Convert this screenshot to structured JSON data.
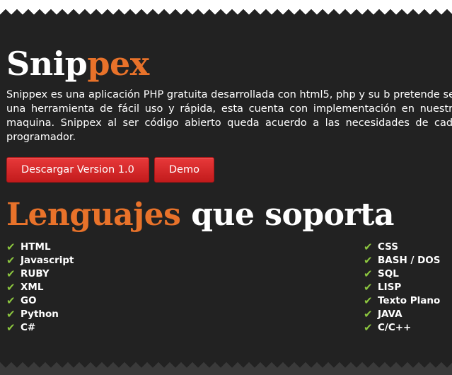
{
  "header": {
    "logo_main": "Snip",
    "logo_accent": "pex",
    "description": "Snippex es una aplicación PHP gratuita desarrollada con html5, php y su b pretende ser una herramienta de fácil uso y rápida, esta cuenta con implementación en nuestra maquina. Snippex al ser código abierto queda acuerdo a las necesidades de cada programador."
  },
  "buttons": {
    "download_label": "Descargar Version 1.0",
    "demo_label": "Demo"
  },
  "languages": {
    "title_accent": "Lenguajes",
    "title_rest": " que soporta",
    "left": [
      "HTML",
      "Javascript",
      "RUBY",
      "XML",
      "GO",
      "Python",
      "C#"
    ],
    "right": [
      "CSS",
      "BASH / DOS",
      "SQL",
      "LISP",
      "Texto Plano",
      "JAVA",
      "C/C++"
    ]
  },
  "colors": {
    "accent": "#e8722a",
    "button_red": "#d42a2b",
    "check_green": "#8cc63f",
    "background": "#222222"
  },
  "icons": {
    "check": "check-icon"
  }
}
